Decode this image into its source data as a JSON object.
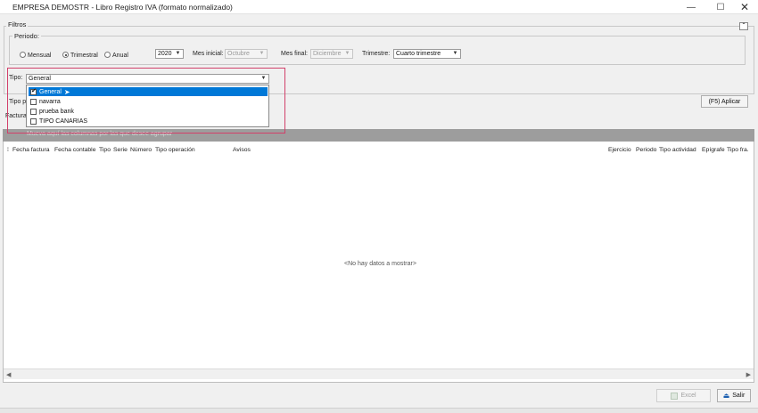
{
  "window": {
    "title": "EMPRESA DEMOSTR - Libro Registro IVA (formato normalizado)",
    "minimize_icon": "minimize-icon",
    "maximize_icon": "maximize-icon",
    "close_icon": "close-icon"
  },
  "filters": {
    "group_label": "Filtros",
    "collapse_icon": "chevron-up-icon",
    "periodo": {
      "label": "Periodo:",
      "options": [
        "Mensual",
        "Trimestral",
        "Anual"
      ],
      "selected": "Trimestral"
    },
    "year": "2020",
    "mes_inicial": {
      "label": "Mes inicial:",
      "value": "Octubre"
    },
    "mes_final": {
      "label": "Mes final:",
      "value": "Diciembre"
    },
    "trimestre": {
      "label": "Trimestre:",
      "value": "Cuarto trimestre"
    },
    "tipo": {
      "label": "Tipo:",
      "value": "General",
      "options": [
        {
          "label": "General",
          "checked": true,
          "selected": true
        },
        {
          "label": "navarra",
          "checked": false,
          "selected": false
        },
        {
          "label": "prueba bank",
          "checked": false,
          "selected": false
        },
        {
          "label": "TIPO CANARIAS",
          "checked": false,
          "selected": false
        }
      ]
    },
    "tipo_partial_label": "Tipo p",
    "factura_partial_label": "Factura",
    "apply_button": "(F5) Aplicar"
  },
  "grid": {
    "group_hint": "Mueva aquí las columnas por las que desee agrupar",
    "columns": [
      "Fecha factura",
      "Fecha contable",
      "Tipo",
      "Serie",
      "Número",
      "Tipo operación",
      "Avisos",
      "Ejercicio",
      "Periodo",
      "Tipo actividad",
      "Epígrafe",
      "Tipo fra."
    ],
    "empty_text": "<No hay datos a mostrar>"
  },
  "footer": {
    "excel_button": "Excel",
    "exit_button": "Salir"
  },
  "colors": {
    "selection": "#0078d7",
    "highlight_frame": "#d2406a",
    "group_bar": "#9d9d9d"
  }
}
